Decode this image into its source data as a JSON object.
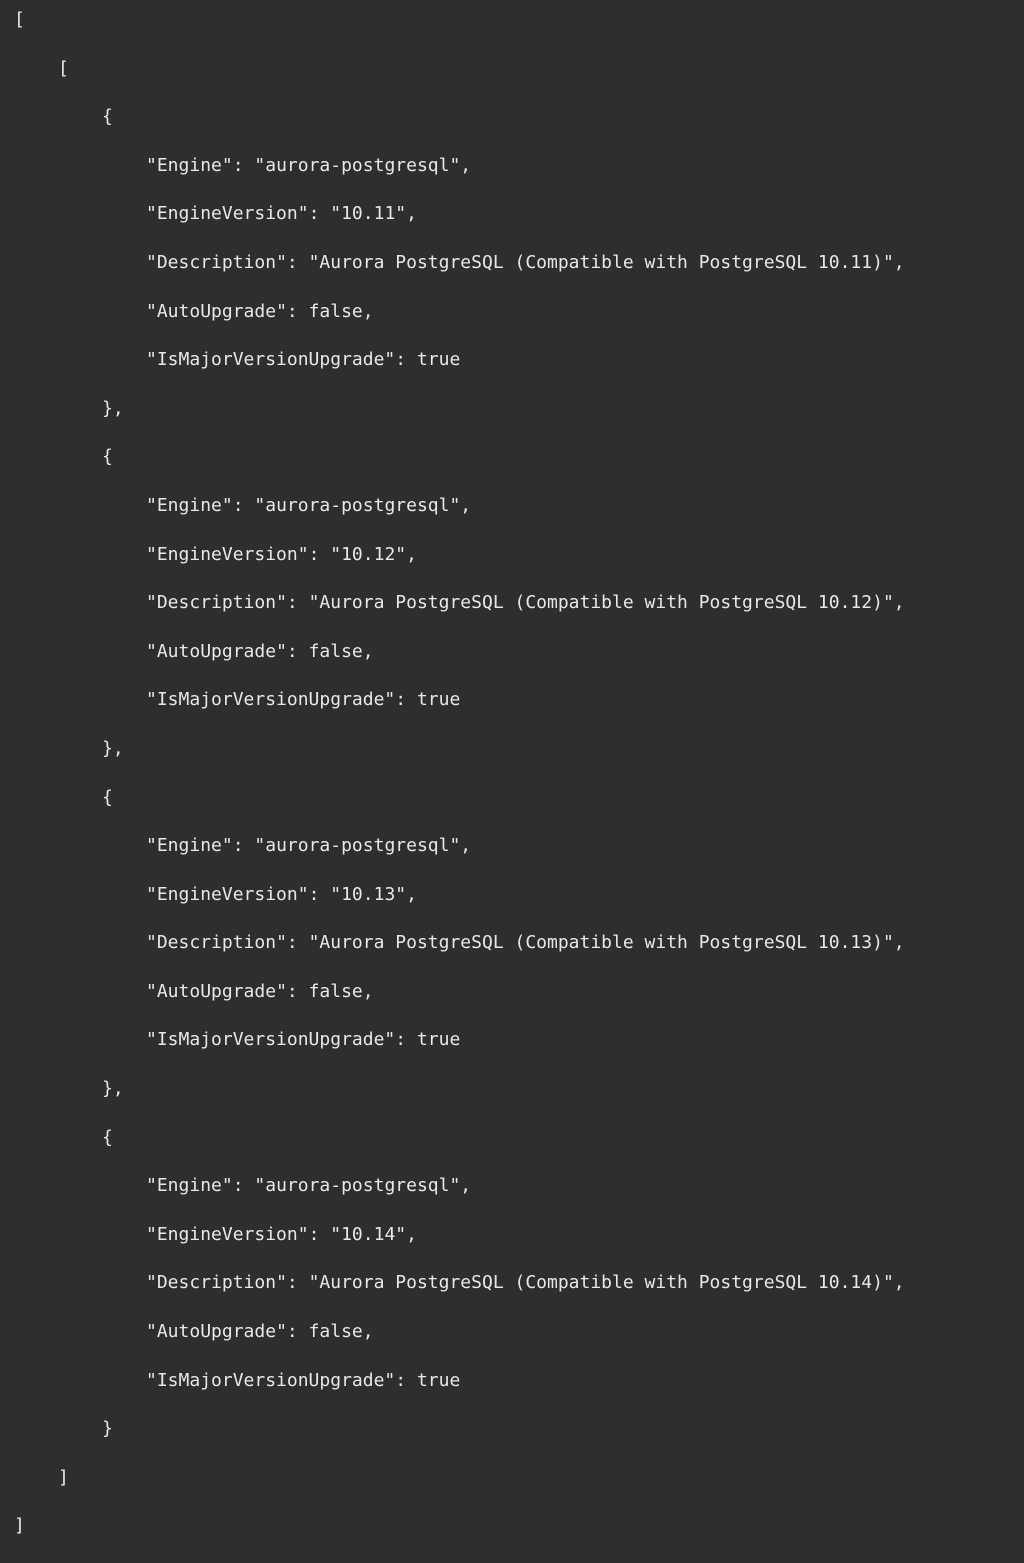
{
  "engine": "aurora-postgresql",
  "auto_upgrade": "false",
  "is_major": "true",
  "items": [
    {
      "version": "10.11",
      "description": "Aurora PostgreSQL (Compatible with PostgreSQL 10.11)"
    },
    {
      "version": "10.12",
      "description": "Aurora PostgreSQL (Compatible with PostgreSQL 10.12)"
    },
    {
      "version": "10.13",
      "description": "Aurora PostgreSQL (Compatible with PostgreSQL 10.13)"
    },
    {
      "version": "10.14",
      "description": "Aurora PostgreSQL (Compatible with PostgreSQL 10.14)"
    }
  ],
  "keys": {
    "engine": "Engine",
    "engine_version": "EngineVersion",
    "description": "Description",
    "auto_upgrade": "AutoUpgrade",
    "is_major": "IsMajorVersionUpgrade"
  },
  "punct": {
    "lbracket": "[",
    "rbracket": "]",
    "lbrace": "{",
    "rbrace_comma": "},",
    "rbrace": "}"
  }
}
